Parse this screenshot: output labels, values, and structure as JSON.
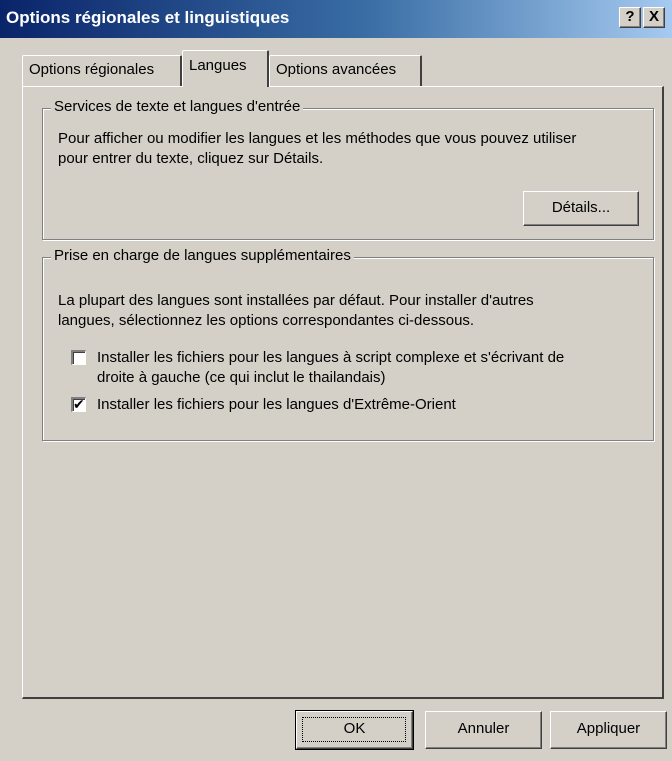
{
  "window": {
    "title": "Options régionales et linguistiques",
    "help_button": "?",
    "close_button": "X"
  },
  "tabs": [
    {
      "label": "Options régionales",
      "active": false
    },
    {
      "label": "Langues",
      "active": true
    },
    {
      "label": "Options avancées",
      "active": false
    }
  ],
  "text_services": {
    "group_title": "Services de texte et langues d'entrée",
    "description_line1": "Pour afficher ou modifier les langues et les méthodes que vous pouvez utiliser",
    "description_line2": "pour entrer du texte, cliquez sur Détails.",
    "details_button": "Détails..."
  },
  "supplemental": {
    "group_title": "Prise en charge de langues supplémentaires",
    "description_line1": "La plupart des langues sont installées par défaut. Pour installer d'autres",
    "description_line2": "langues, sélectionnez les options correspondantes ci-dessous.",
    "options": [
      {
        "label_line1": "Installer les fichiers pour les langues à script complexe et s'écrivant de",
        "label_line2": "droite à gauche (ce qui inclut le thailandais)",
        "checked": false
      },
      {
        "label_line1": "Installer les fichiers pour les langues d'Extrême-Orient",
        "checked": true
      }
    ]
  },
  "footer": {
    "ok_button": "OK",
    "cancel_button": "Annuler",
    "apply_button": "Appliquer"
  }
}
